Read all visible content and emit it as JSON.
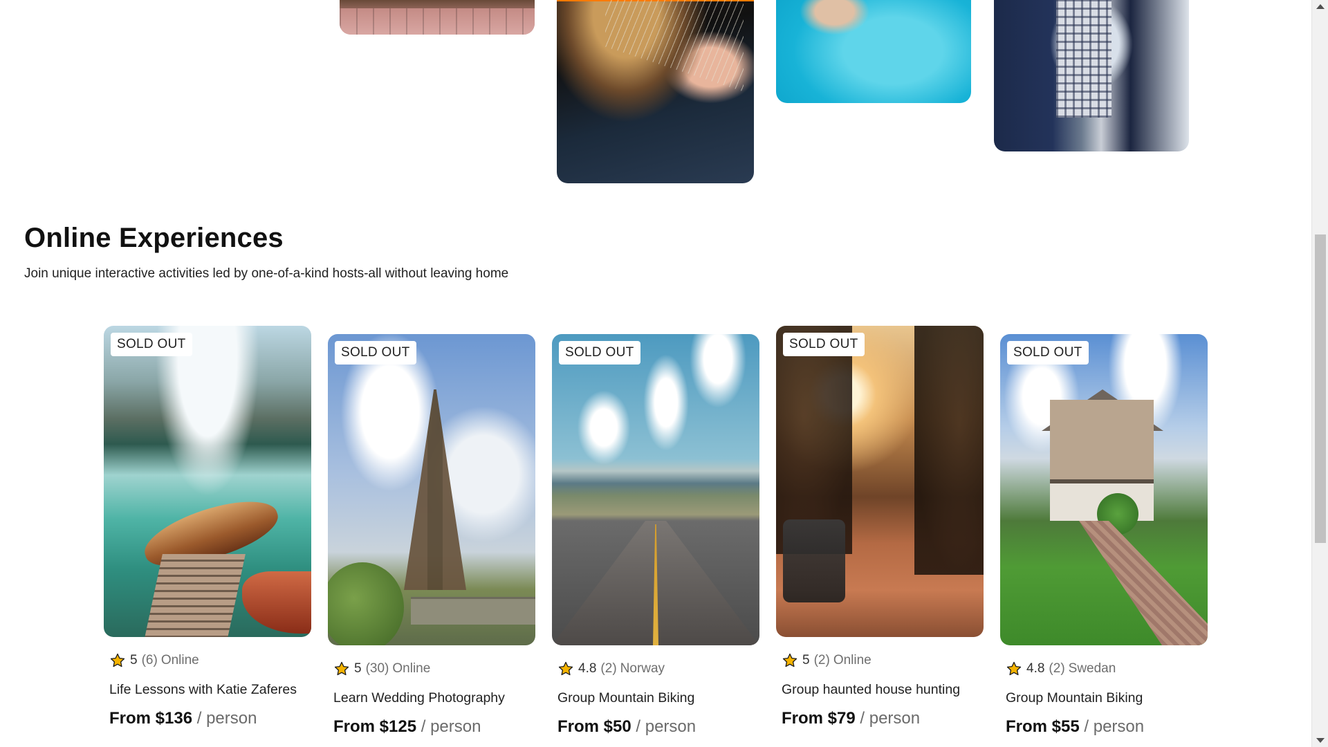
{
  "section": {
    "title": "Online Experiences",
    "subtitle": "Join unique interactive activities led by one-of-a-kind hosts-all without leaving home"
  },
  "cards": [
    {
      "badge": "SOLD OUT",
      "rating": "5",
      "reviews": "(6)",
      "location": "Online",
      "title": "Life Lessons with Katie Zaferes",
      "price": "From $136",
      "per": "/ person"
    },
    {
      "badge": "SOLD OUT",
      "rating": "5",
      "reviews": "(30)",
      "location": "Online",
      "title": "Learn Wedding Photography",
      "price": "From $125",
      "per": "/ person"
    },
    {
      "badge": "SOLD OUT",
      "rating": "4.8",
      "reviews": "(2)",
      "location": "Norway",
      "title": "Group Mountain Biking",
      "price": "From $50",
      "per": "/ person"
    },
    {
      "badge": "SOLD OUT",
      "rating": "5",
      "reviews": "(2)",
      "location": "Online",
      "title": "Group haunted house hunting",
      "price": "From $79",
      "per": "/ person"
    },
    {
      "badge": "SOLD OUT",
      "rating": "4.8",
      "reviews": "(2)",
      "location": "Swedan",
      "title": "Group Mountain Biking",
      "price": "From $55",
      "per": "/ person"
    }
  ],
  "icons": {
    "rating": "star-icon"
  },
  "colors": {
    "star_fill": "#f5b301",
    "star_stroke": "#1a1a1a",
    "accent": "#ff7a00"
  }
}
